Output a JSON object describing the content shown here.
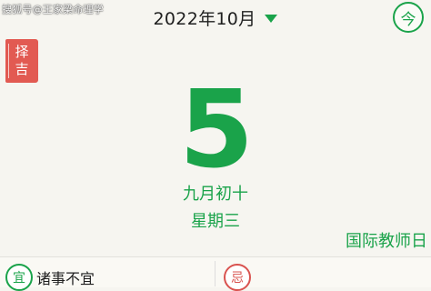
{
  "watermark": "搜狐号@王家梁命理学",
  "header": {
    "month_label": "2022年10月",
    "dropdown_icon": "triangle-down-icon",
    "today_label": "今"
  },
  "sidebar": {
    "zeji_line1": "择",
    "zeji_line2": "吉"
  },
  "day": {
    "number": "5",
    "lunar": "九月初十",
    "weekday": "星期三",
    "festival": "国际教师日"
  },
  "footer": {
    "yi_badge": "宜",
    "yi_text": "诸事不宜",
    "ji_badge": "忌"
  },
  "colors": {
    "accent": "#1aa34a",
    "ji_red": "#d9534f",
    "zeji_tab": "#e25a52",
    "background": "#f6f5f0"
  }
}
